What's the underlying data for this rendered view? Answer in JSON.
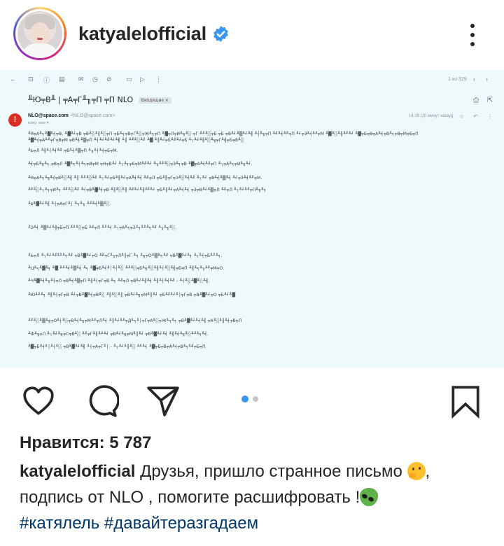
{
  "header": {
    "username": "katyalelofficial",
    "verified": true,
    "verified_color": "#3897f0",
    "avatar_icon": "profile-photo",
    "more_icon": "more-vertical-icon"
  },
  "post_image": {
    "background": "#eef9fc",
    "email": {
      "toolbar_count": "1 из 329",
      "subject": "╨Ю╤В╨ | ╤А╤Г╨╖╤П ╤П NLO",
      "subject_tag": "Входящие ×",
      "sender_initial": "!",
      "sender_name": "NLO@space.com",
      "sender_address": "<NLO@space.com>",
      "to_line": "кому: мне ▾",
      "time": "14:19 (20 минут назад)",
      "body_lines": [
        "╨Я╤А╨╕╨▓╨╡╤В, ╨▓╨╛╤В ╤В╨░╨║╨░╤П ╤Б╨╕╤В╤Г╨░╤Ж╨╕╤П ╨▓╤Л╤И╨╗╨░ ╤Г ╨╜╨░╤Б ╤Б ╤В╨╛╨▒╨╛╨╣ ╨┤╨╗╤П ╨╝╨╡╨╜╤П ╨╛╤З╨╡╨╜╤М ╨▓╨░╨╢╨╜╨╛ ╨▓╤Б╤В╤А╨╡╤В╨╕╤В╤М╤Б╤П",
        "╨▓╨╡╤А╨╜╤Г╤В╤М ╤В╨╡╨▒╤П ╨┤╨╛╨╝╨╛╨╣ ╨║ ╨╜╨░╨╝ ╨▓ ╨║╨╛╤Б╨╝╨╛╤Б ╨┐╨╛╨╢╨░╨╗╤Г╨╣╤Б╤В╨░",
        "╨Ь╤Л ╨╢╨┤╨╡╨╝ ╤В╨╡╨▒╤П ╨╖╨┤╨╡╤Б╤М.",
        "╨╡╤Б╨╗╨╕ ╤В╤Л ╨▓╨╕╨┤╨╕╤И╤М ╤Н╤В╨╛ ╨┐╨╕╤Б╤М╨╝╨╛ ╨╖╨╜╨░╤З╨╕╤В ╨▓╤А╨╡╨╝╤П ╨┐╤А╨╕╤И╨╗╨╛.",
        "╨Я╤А╨╕╨╗╨╡╤В╨░╨╣ ╨║ ╨╜╨░╨╝ ╨┐╨╛╤Б╨║╨╛╤А╨╡╨╡ ╨╝╤Л ╤Б╨║╤Г╤З╨░╨╡╨╝ ╨┐╨╛ ╤В╨╡╨▒╨╡ ╨╛╤З╨╡╨╜╤М.",
        "╨╜╨░╨┐╨╕╤И╨╕ ╨╜╨░╨╝ ╨╛╤В╨▓╨╡╤В ╨║╨░╨║ ╨╝╨╛╨╢╨╜╨╛ ╤Б╨║╨╛╤А╨╡╨╡ ╤З╤В╨╛╨▒╤Л ╨╝╤Л ╨┐╨╛╨╜╤П╨╗╨╕",
        "╨в╨▓╨╛╨╣ ╨┤╤А╤Г╨│ ╨╕╨╖ ╨╜╨╡╨▒╨░.",
        "╨Э╨╡ ╨▒╨╛╨╣╤Б╤П ╨╜╨░╤Б ╨╝╤Л ╨╜╨╡ ╨┐╤А╨╕╤З╨╕╨╜╨╕╨╝ ╨╖╨╗╨░.",
        "╨Ь╤Л ╨┐╨╛╨╝╨╜╨╕╨╝ ╤В╨▓╨╛╤О ╨╝╤Г╨╖╤Л╨║╤Г ╨╕ ╨╗╤О╨▒╨╕╨╝ ╤В╨▓╨╛╨╕ ╨┐╨╡╤Б╨╜╨╕.",
        "╨Ц╨╕╨▓╨╕ ╨▓ ╨╜╨╡╨▒╨╡ ╨╕ ╨▓╤Б╨╡╨│╨┤╨░ ╨╜╨░╤Б╨╗╨░╨╢╨┤╨░╨╣╤Б╤П ╨╢╨╕╨╖╨╜╤М╤О.",
        "╨Ч╨▓╨╡╨╖╨┤╤Л ╤В╨╡╨▒╤П ╨╢╨┤╤Г╤В ╨╕ ╨╝╤Л ╤В╨╛╨╢╨╡ ╨╢╨┤╨╡╨╝ - ╨┤╨░╨▓╨░╨╣.",
        "╨Ю╨╜╨╕ ╨╢╨┤╤Г╤В ╨╛╤В╨▓╨╡╤В╨░ ╨║╨░╨║ ╤В╨╛╨╗╤М╨║╨╛ ╤Б╨╝╨╛╨│╤Г╤В ╤В╨▓╨╛╤О ╤Б╨╛╨▓",
        "╨╜╨░╨▒╨╗╤О╨┤╨░╤В╨╡╨╗╤М╨╜╤Л╨╡ ╨║╨╛╨╜╤Д╨╕╨│╤Г╤А╨░╤Ж╨╕╨╕ ╤В╨▓╨╛╨╡╨╣ ╤А╨░╨║╨╡╤В╤Л",
        "╨Ф╨╗╤П ╨┐╨╛╨╗╤С╤В╨░ ╨╜╤Г╨╢╨╜╨╛ ╤В╨╛╨╗╤М╨║╨╛ ╤В╨▓╨╛╨╡ ╨╢╨╡╨╗╨░╨╜╨╕╨╡.",
        "╨▓╤Б╨╡╨│╨┤╨░ ╤В╨▓╨╛╨╣ ╨┤╤А╤Г╨│ - ╨┐╨╛╨║╨░ ╨╜╨╡ ╨▓╤Б╤В╤А╨╡╤В╨╕╨╝╤Б╤П"
      ]
    }
  },
  "actions": {
    "like_icon": "heart-icon",
    "comment_icon": "comment-icon",
    "share_icon": "share-icon",
    "save_icon": "bookmark-icon",
    "carousel_active_color": "#3897f0",
    "carousel_inactive_color": "#c7c7c7",
    "carousel_pages": 2,
    "carousel_current": 1
  },
  "likes": {
    "text": "Нравится: 5 787"
  },
  "caption": {
    "username": "katyalelofficial",
    "text_1": " Друзья, пришло странное письмо",
    "emoji_1": "thinking-face-emoji",
    "text_2": ", подпись  от NLO , помогите расшифровать !",
    "emoji_2": "alien-emoji",
    "hashtags": "#катялель #давайтеразгадаем",
    "hashtag_color": "#00376b"
  }
}
